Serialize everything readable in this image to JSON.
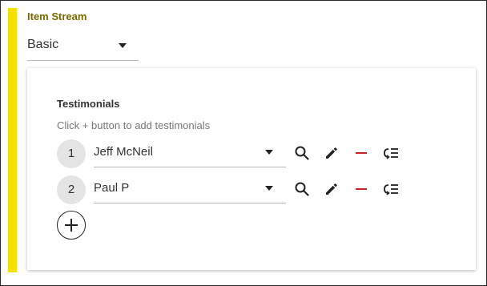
{
  "section": {
    "title": "Item Stream",
    "type_select": {
      "value": "Basic"
    }
  },
  "panel": {
    "title": "Testimonials",
    "hint": "Click + button to add testimonials",
    "rows": [
      {
        "index": "1",
        "value": "Jeff McNeil"
      },
      {
        "index": "2",
        "value": "Paul P"
      }
    ]
  },
  "icons": {
    "search": "search-icon",
    "edit": "pencil-icon",
    "remove": "minus-icon",
    "reorder": "list-reorder-icon",
    "add": "plus-icon"
  },
  "colors": {
    "accent": "#f4e100",
    "section_title": "#7a6a00",
    "remove": "#c62828"
  }
}
